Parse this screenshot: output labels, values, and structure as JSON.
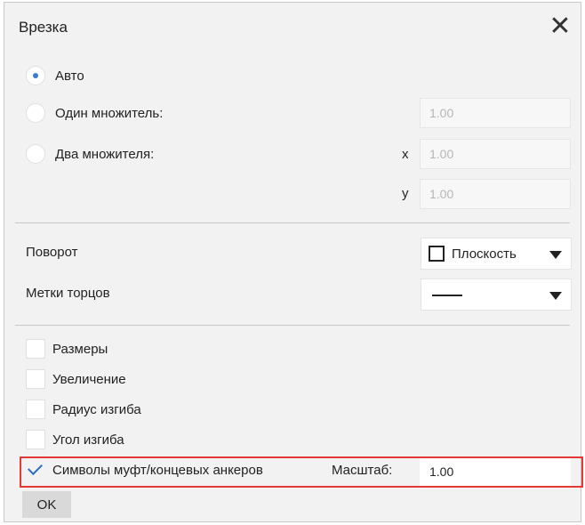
{
  "dialog": {
    "title": "Врезка",
    "close_icon": "close-icon"
  },
  "scale_mode": {
    "options": [
      {
        "label": "Авто",
        "selected": true
      },
      {
        "label": "Один множитель:",
        "selected": false
      },
      {
        "label": "Два множителя:",
        "selected": false
      }
    ],
    "single_factor_value": "1.00",
    "x_label": "x",
    "x_value": "1.00",
    "y_label": "y",
    "y_value": "1.00"
  },
  "rotation": {
    "label": "Поворот",
    "value": "Плоскость"
  },
  "end_marks": {
    "label": "Метки торцов",
    "value_icon": "solid-line-icon"
  },
  "options": {
    "items": [
      {
        "label": "Размеры",
        "checked": false
      },
      {
        "label": "Увеличение",
        "checked": false
      },
      {
        "label": "Радиус изгиба",
        "checked": false
      },
      {
        "label": "Угол изгиба",
        "checked": false
      },
      {
        "label": "Символы муфт/концевых анкеров",
        "checked": true
      }
    ],
    "scale_label": "Масштаб:",
    "scale_value": "1.00"
  },
  "buttons": {
    "ok_label": "OK"
  },
  "colors": {
    "accent": "#3a7bd5",
    "highlight": "#e53935"
  }
}
